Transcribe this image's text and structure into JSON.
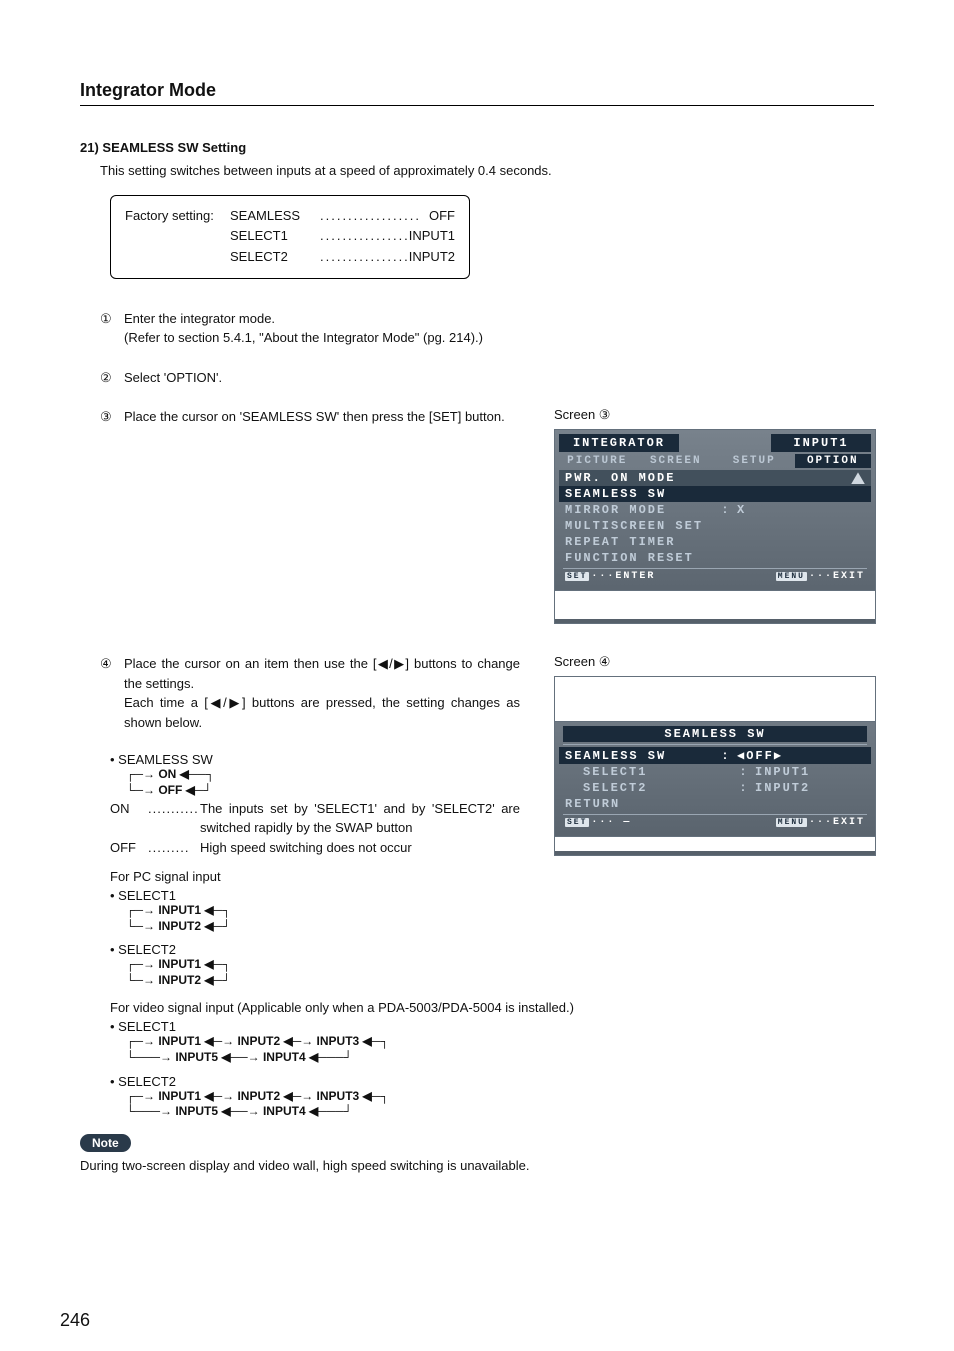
{
  "header": {
    "title": "Integrator Mode"
  },
  "section": {
    "heading": "21) SEAMLESS SW Setting",
    "intro": "This setting switches between inputs at a speed of approximately 0.4 seconds."
  },
  "factory": {
    "label": "Factory setting:",
    "rows": [
      {
        "key": "SEAMLESS",
        "dots": "..................",
        "val": "OFF"
      },
      {
        "key": "SELECT1",
        "dots": ".......................",
        "val": "INPUT1"
      },
      {
        "key": "SELECT2",
        "dots": ".......................",
        "val": "INPUT2"
      }
    ]
  },
  "steps": {
    "s1_num": "①",
    "s1_a": "Enter the integrator mode.",
    "s1_b": "(Refer to section 5.4.1, \"About the Integrator Mode\" (pg. 214).)",
    "s2_num": "②",
    "s2": "Select 'OPTION'.",
    "s3_num": "③",
    "s3": "Place the cursor on 'SEAMLESS SW' then press the [SET] button.",
    "s4_num": "④",
    "s4_a": "Place the cursor on an item then use the [◀/▶] buttons to change the settings.",
    "s4_b": "Each time a [◀/▶] buttons are pressed, the setting changes as shown below."
  },
  "screen_labels": {
    "s3": "Screen ③",
    "s4": "Screen ④"
  },
  "osd3": {
    "title": "INTEGRATOR",
    "input": "INPUT1",
    "tabs": [
      "PICTURE",
      "SCREEN",
      "SETUP",
      "OPTION"
    ],
    "rows": [
      {
        "k": "PWR. ON MODE",
        "arrow": true
      },
      {
        "k": "SEAMLESS SW"
      },
      {
        "k": "MIRROR MODE",
        "sep": ":",
        "v": "X"
      },
      {
        "k": "MULTISCREEN SET"
      },
      {
        "k": "REPEAT TIMER"
      },
      {
        "k": "FUNCTION RESET"
      }
    ],
    "footer": {
      "left_tag": "SET",
      "left": "···ENTER",
      "right_tag": "MENU",
      "right": "···EXIT"
    }
  },
  "osd4": {
    "title": "SEAMLESS SW",
    "rows": [
      {
        "k": "SEAMLESS SW",
        "sep": ":",
        "v": "◀OFF▶"
      },
      {
        "k": "  SELECT1",
        "sep": ":",
        "v": "INPUT1"
      },
      {
        "k": "  SELECT2",
        "sep": ":",
        "v": "INPUT2"
      },
      {
        "k": "RETURN"
      }
    ],
    "footer": {
      "left_tag": "SET",
      "left": "··· —",
      "right_tag": "MENU",
      "right": "···EXIT"
    }
  },
  "cycle_seamless": {
    "label": "• SEAMLESS SW",
    "on": "ON",
    "off": "OFF"
  },
  "defs": {
    "on_key": "ON",
    "on_dots": "...........",
    "on_val": "The inputs set by 'SELECT1' and by 'SELECT2' are switched rapidly by the SWAP button",
    "off_key": "OFF",
    "off_dots": ".........",
    "off_val": "High speed switching does not occur"
  },
  "pc": {
    "heading": "For PC signal input",
    "sel1": "• SELECT1",
    "sel2": "• SELECT2",
    "i1": "INPUT1",
    "i2": "INPUT2"
  },
  "video": {
    "heading": "For video signal input (Applicable only when a PDA-5003/PDA-5004 is installed.)",
    "sel1": "• SELECT1",
    "sel2": "• SELECT2",
    "i1": "INPUT1",
    "i2": "INPUT2",
    "i3": "INPUT3",
    "i4": "INPUT4",
    "i5": "INPUT5"
  },
  "note": {
    "badge": "Note",
    "text": "During two-screen display and video wall, high speed switching is unavailable."
  },
  "page_number": "246"
}
